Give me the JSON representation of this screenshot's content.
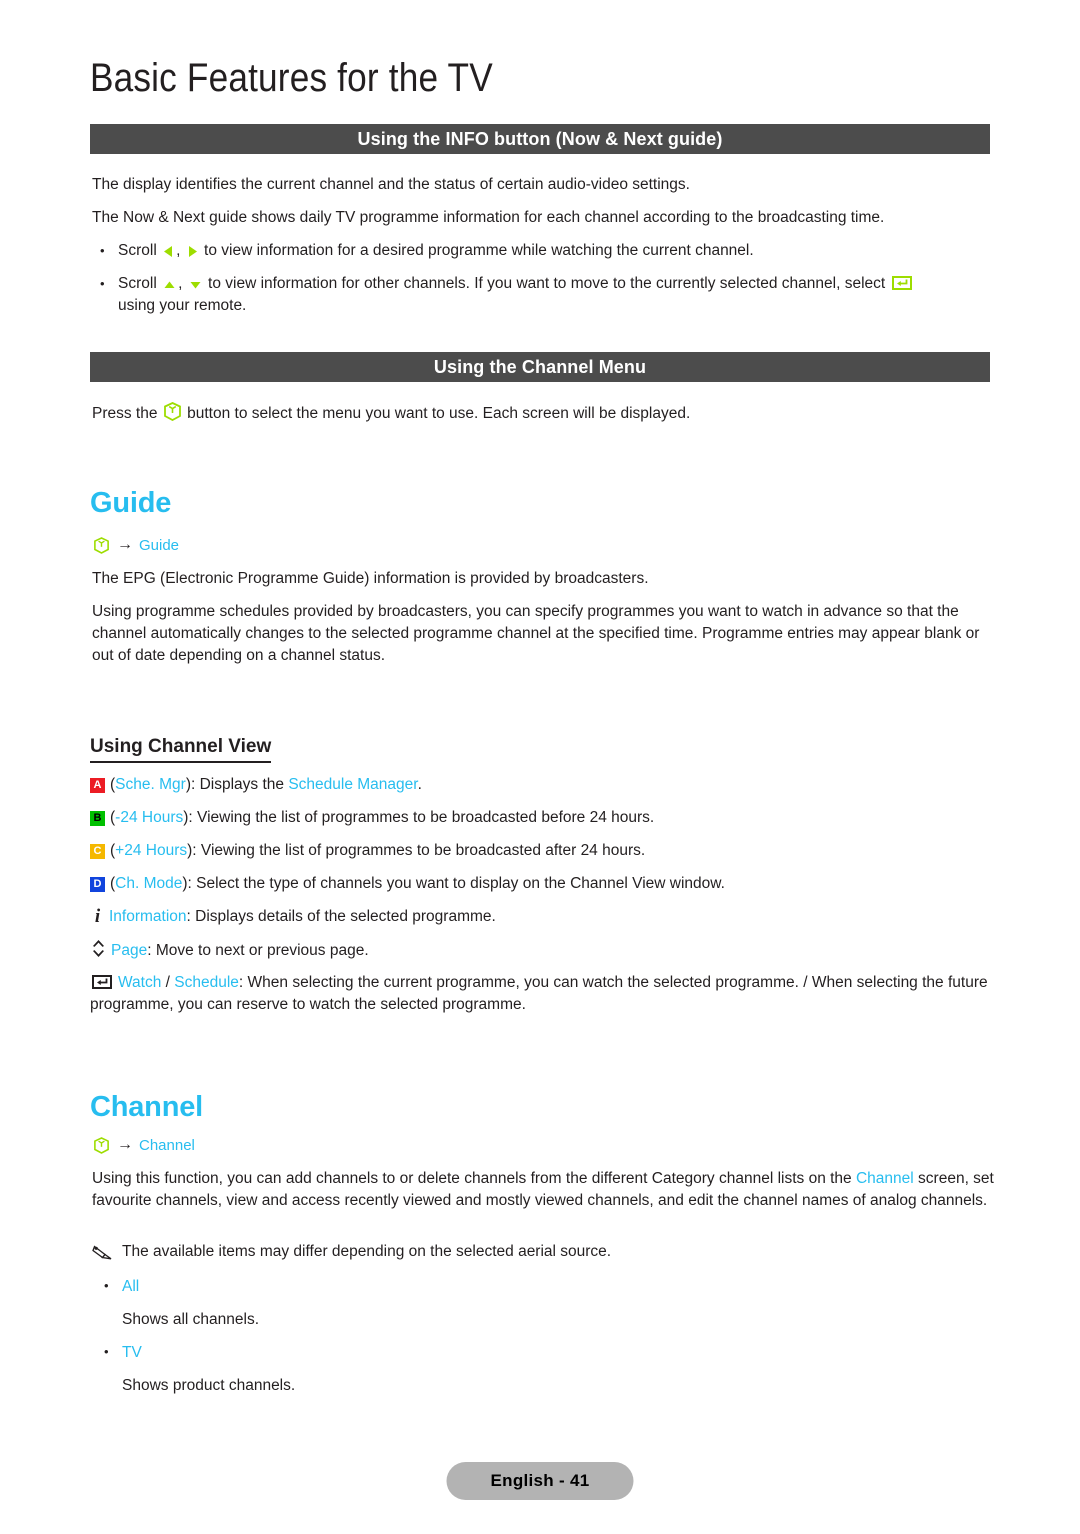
{
  "page": {
    "chapter_title": "Basic Features for the TV",
    "footer_label": "English - 41"
  },
  "colors": {
    "section_bar_bg": "#4c4c4c",
    "heading_cyan": "#27bdef",
    "key_green": "#9ddd00",
    "badge_a": "#ec1c24",
    "badge_b": "#00c000",
    "badge_c": "#f5b800",
    "badge_d": "#1144dd",
    "footer_bg": "#b3b3b3",
    "body_text": "#231f20"
  },
  "info_section": {
    "bar_title": "Using the INFO button (Now & Next guide)",
    "para1": "The display identifies the current channel and the status of certain audio-video settings.",
    "para2": "The Now & Next guide shows daily TV programme information for each channel according to the broadcasting time.",
    "bullets": [
      {
        "lead": "Scroll",
        "icons": [
          "left-arrow-icon",
          "right-arrow-icon"
        ],
        "text": "to view information for a desired programme while watching the current channel."
      },
      {
        "lead": "Scroll",
        "icons": [
          "up-arrow-icon",
          "down-arrow-icon"
        ],
        "text": "to view information for other channels. If you want to move to the currently selected channel, select",
        "trailing_icon": "enter-icon-green",
        "text_after": "using your remote."
      }
    ]
  },
  "channel_menu_section": {
    "bar_title": "Using the Channel Menu",
    "press_text_before": "Press the",
    "press_icon": "menu-button-icon",
    "press_text_after": "button to select the menu you want to use. Each screen will be displayed."
  },
  "guide_section": {
    "heading": "Guide",
    "path_icon": "menu-button-icon",
    "path_arrow": "→",
    "path_target": "Guide",
    "para1": "The EPG (Electronic Programme Guide) information is provided by broadcasters.",
    "para2": "Using programme schedules provided by broadcasters, you can specify programmes you want to watch in advance so that the channel automatically changes to the selected programme channel at the specified time. Programme entries may appear blank or out of date depending on a channel status.",
    "sub_heading": "Using Channel View",
    "keys": [
      {
        "badge": "A",
        "badge_color": "red",
        "label": "Sche. Mgr",
        "desc_before": "): Displays the ",
        "desc_highlight": "Schedule Manager",
        "desc_after": "."
      },
      {
        "badge": "B",
        "badge_color": "green",
        "label": "-24 Hours",
        "desc_before": "): Viewing the list of programmes to be broadcasted before 24 hours.",
        "desc_highlight": "",
        "desc_after": ""
      },
      {
        "badge": "C",
        "badge_color": "yellow",
        "label": "+24 Hours",
        "desc_before": "): Viewing the list of programmes to be broadcasted after 24 hours.",
        "desc_highlight": "",
        "desc_after": ""
      },
      {
        "badge": "D",
        "badge_color": "blue",
        "label": "Ch. Mode",
        "desc_before": "): Select the type of channels you want to display on the Channel View window.",
        "desc_highlight": "",
        "desc_after": ""
      }
    ],
    "info_key": {
      "icon": "information-i-icon",
      "label": "Information",
      "desc": ": Displays details of the selected programme."
    },
    "page_key": {
      "icon": "page-updown-icon",
      "label": "Page",
      "desc": ": Move to next or previous page."
    },
    "watch_key": {
      "icon": "enter-icon-black",
      "label_1": "Watch",
      "separator": " / ",
      "label_2": "Schedule",
      "desc": ": When selecting the current programme, you can watch the selected programme. / When selecting the future programme, you can reserve to watch the selected programme."
    }
  },
  "channel_section": {
    "heading": "Channel",
    "path_icon": "menu-button-icon",
    "path_arrow": "→",
    "path_target": "Channel",
    "para_part1": "Using this function, you can add channels to or delete channels from the different Category channel lists on the ",
    "para_highlight": "Channel",
    "para_part2": " screen, set favourite channels, view and access recently viewed and mostly viewed channels, and edit the channel names of analog channels.",
    "note": {
      "icon": "pencil-note-icon",
      "text": "The available items may differ depending on the selected aerial source."
    },
    "items": [
      {
        "label": "All",
        "desc": "Shows all channels."
      },
      {
        "label": "TV",
        "desc": "Shows product channels."
      }
    ]
  }
}
